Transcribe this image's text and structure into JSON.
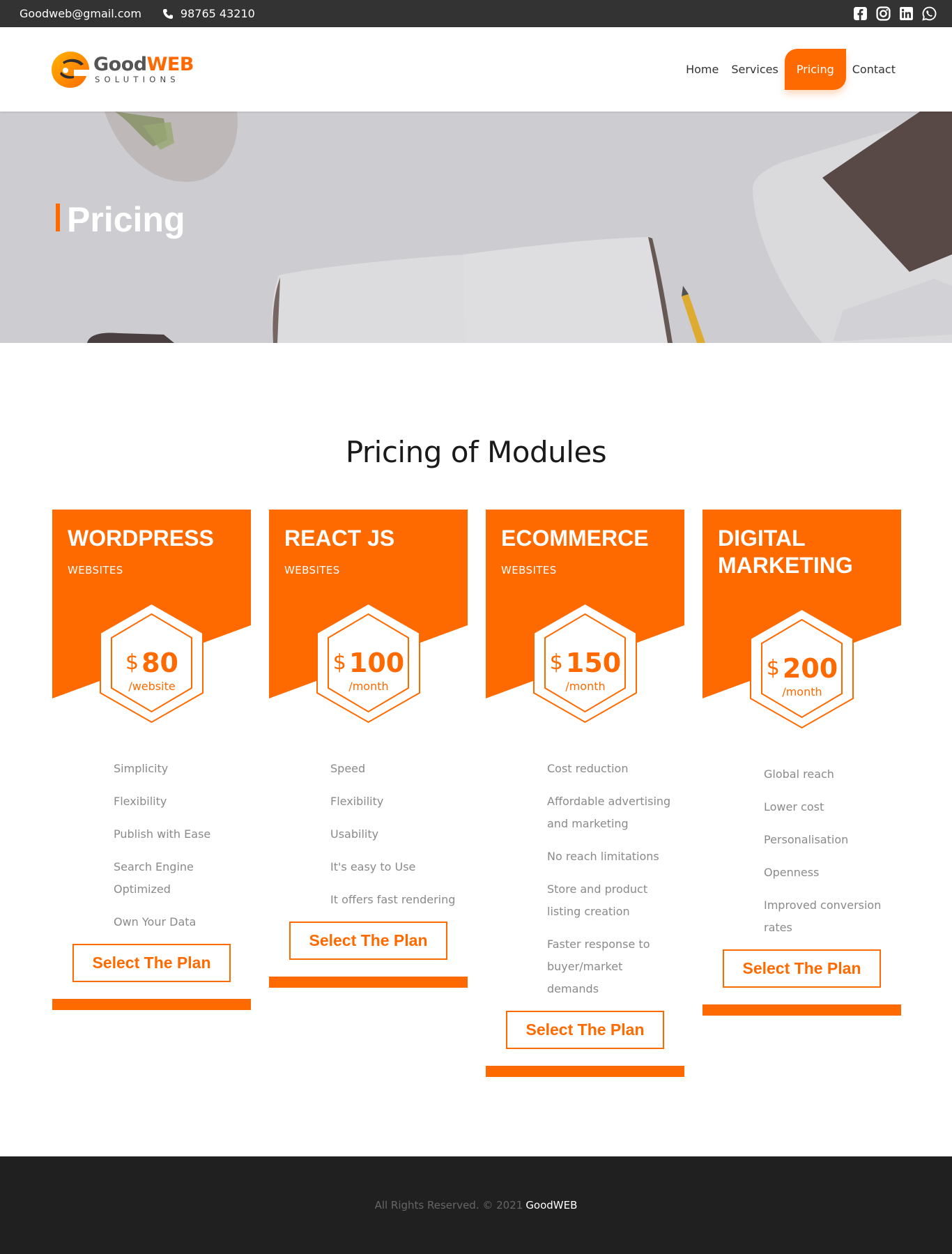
{
  "topbar": {
    "email": "Goodweb@gmail.com",
    "phone": "98765 43210",
    "social": [
      "facebook-icon",
      "instagram-icon",
      "linkedin-icon",
      "whatsapp-icon"
    ]
  },
  "logo": {
    "good": "Good",
    "web": "WEB",
    "tagline": "SOLUTIONS"
  },
  "nav": {
    "items": [
      {
        "label": "Home",
        "active": false
      },
      {
        "label": "Services",
        "active": false
      },
      {
        "label": "Pricing",
        "active": true
      },
      {
        "label": "Contact",
        "active": false
      }
    ]
  },
  "hero": {
    "title": "Pricing"
  },
  "section": {
    "title": "Pricing of Modules"
  },
  "plans": [
    {
      "title": "WORDPRESS",
      "subtitle": "WEBSITES",
      "currency": "$",
      "price": "80",
      "period": "/website",
      "features": [
        "Simplicity",
        "Flexibility",
        "Publish with Ease",
        "Search Engine Optimized",
        "Own Your Data"
      ],
      "button": "Select The Plan"
    },
    {
      "title": "REACT JS",
      "subtitle": "WEBSITES",
      "currency": "$",
      "price": "100",
      "period": "/month",
      "features": [
        "Speed",
        "Flexibility",
        "Usability",
        "It's easy to Use",
        "It offers fast rendering"
      ],
      "button": "Select The Plan"
    },
    {
      "title": "ECOMMERCE",
      "subtitle": "WEBSITES",
      "currency": "$",
      "price": "150",
      "period": "/month",
      "features": [
        "Cost reduction",
        "Affordable advertising and marketing",
        "No reach limitations",
        "Store and product listing creation",
        "Faster response to buyer/market demands"
      ],
      "button": "Select The Plan"
    },
    {
      "title": "DIGITAL MARKETING",
      "subtitle": "",
      "currency": "$",
      "price": "200",
      "period": "/month",
      "features": [
        "Global reach",
        "Lower cost",
        "Personalisation",
        "Openness",
        "Improved conversion rates"
      ],
      "button": "Select The Plan"
    }
  ],
  "footer": {
    "text": "All Rights Reserved. © 2021",
    "brand": "GoodWEB"
  },
  "colors": {
    "accent": "#ff6a00",
    "topbar": "#333333",
    "footer": "#202020"
  }
}
